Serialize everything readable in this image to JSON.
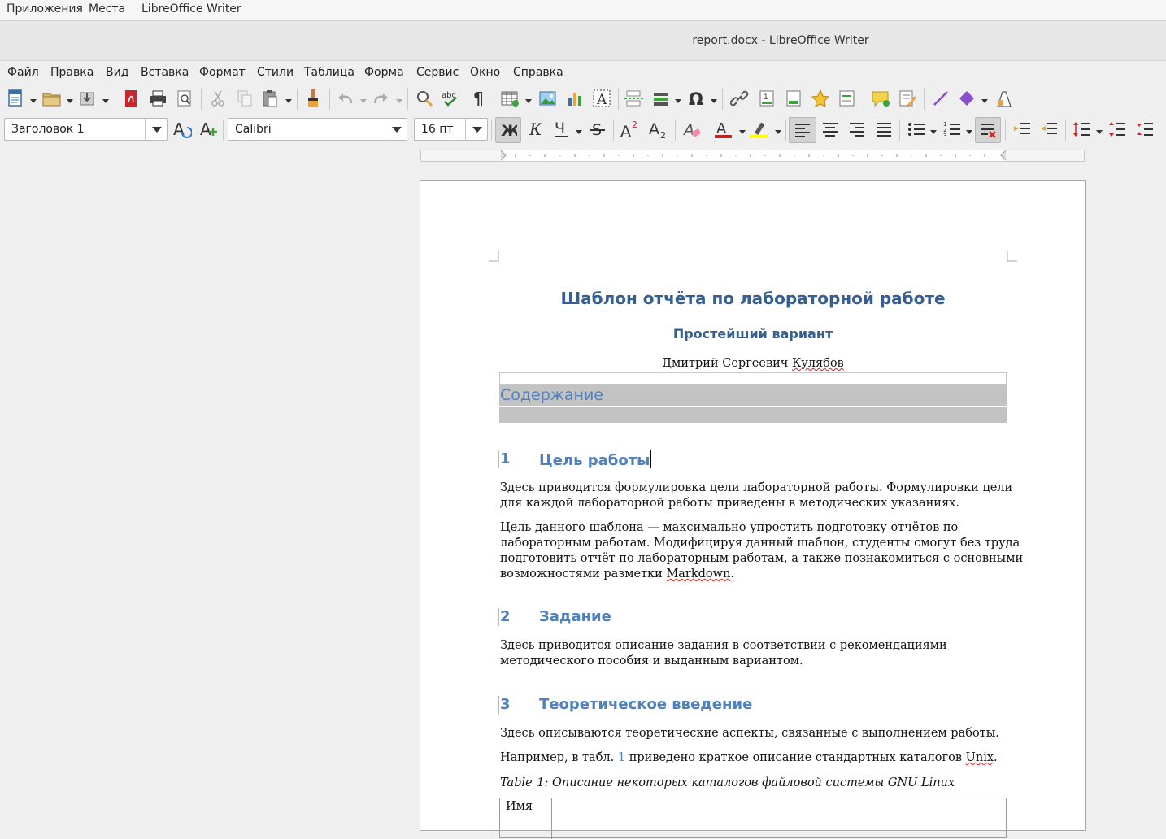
{
  "system_bar": {
    "apps": "Приложения",
    "places": "Места",
    "app_name": "LibreOffice Writer"
  },
  "window": {
    "title": "report.docx - LibreOffice Writer"
  },
  "menu": [
    "Файл",
    "Правка",
    "Вид",
    "Вставка",
    "Формат",
    "Стили",
    "Таблица",
    "Форма",
    "Сервис",
    "Окно",
    "Справка"
  ],
  "format_bar": {
    "paragraph_style": "Заголовок 1",
    "font_name": "Calibri",
    "font_size": "16 пт"
  },
  "colors": {
    "heading": "#365f91",
    "heading1": "#4f81bd",
    "font_color": "#c9211e",
    "highlight": "#ffff00"
  },
  "document": {
    "title": "Шаблон отчёта по лабораторной работе",
    "subtitle": "Простейший вариант",
    "author_first": "Дмитрий Сергеевич ",
    "author_last": "Кулябов",
    "toc_title": "Содержание",
    "sections": [
      {
        "num": "1",
        "title": "Цель работы"
      },
      {
        "num": "2",
        "title": "Задание"
      },
      {
        "num": "3",
        "title": "Теоретическое введение"
      }
    ],
    "p1_line1": "Здесь приводится формулировка цели лабораторной работы. Формулировки цели",
    "p1_line2": "для каждой лабораторной работы приведены в методических указаниях.",
    "p2_line1": "Цель данного шаблона — максимально упростить подготовку отчётов по",
    "p2_line2": "лабораторным работам. Модифицируя данный шаблон, студенты смогут без труда",
    "p2_line3": "подготовить отчёт по лабораторным работам, а также познакомиться с основными",
    "p2_line4a": "возможностями разметки ",
    "p2_line4b": "Markdown",
    "p2_line4c": ".",
    "p3_line1": "Здесь приводится описание задания в соответствии с рекомендациями",
    "p3_line2": "методического пособия и выданным вариантом.",
    "p4": "Здесь описываются теоретические аспекты, связанные с выполнением работы.",
    "p5a": "Например, в табл. ",
    "p5ref": "1",
    "p5b": " приведено краткое описание стандартных каталогов ",
    "p5c": "Unix",
    "p5d": ".",
    "caption_a": "Table",
    "caption_b": " 1: Описание некоторых каталогов файловой системы GNU Linux",
    "table_header_first": "Имя"
  }
}
